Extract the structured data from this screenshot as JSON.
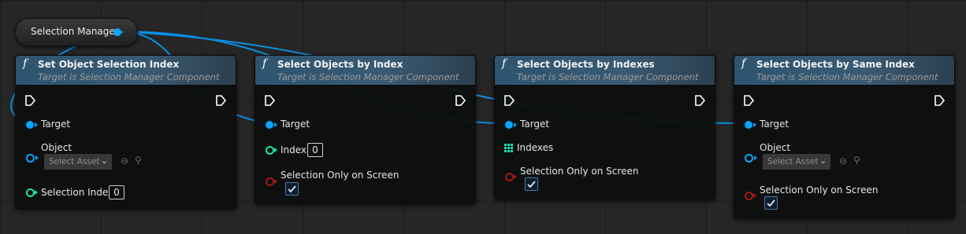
{
  "variable": {
    "label": "Selection Manager"
  },
  "nodes": [
    {
      "title": "Set Object Selection Index",
      "subtitle": "Target is Selection Manager Component",
      "target_label": "Target",
      "object_label": "Object",
      "asset_placeholder": "Select Asset",
      "index_label": "Selection Index",
      "index_value": "0"
    },
    {
      "title": "Select Objects by Index",
      "subtitle": "Target is Selection Manager Component",
      "target_label": "Target",
      "index_label": "Index",
      "index_value": "0",
      "screen_label": "Selection Only on Screen",
      "screen_checked": true
    },
    {
      "title": "Select Objects by Indexes",
      "subtitle": "Target is Selection Manager Component",
      "target_label": "Target",
      "indexes_label": "Indexes",
      "screen_label": "Selection Only on Screen",
      "screen_checked": true
    },
    {
      "title": "Select Objects by Same Index",
      "subtitle": "Target is Selection Manager Component",
      "target_label": "Target",
      "object_label": "Object",
      "asset_placeholder": "Select Asset",
      "screen_label": "Selection Only on Screen",
      "screen_checked": true
    }
  ],
  "colors": {
    "object_pin": "#0aa3ff",
    "int_pin": "#1fe0b0",
    "bool_pin": "#a01818",
    "header": "#2e5470"
  }
}
